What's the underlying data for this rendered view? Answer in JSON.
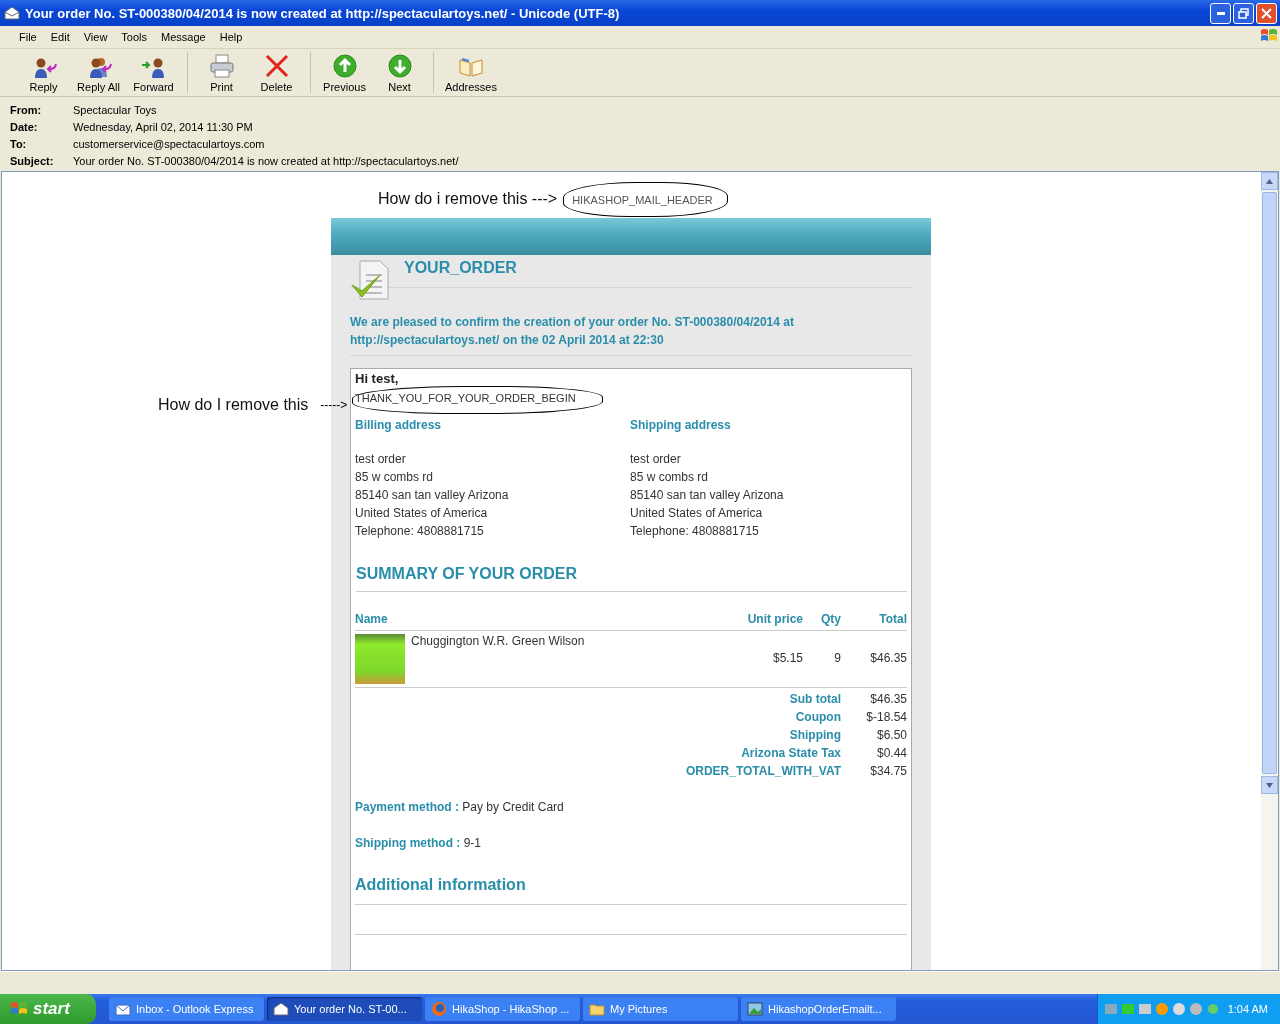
{
  "window": {
    "title": "Your order No. ST-000380/04/2014 is now created at http://spectaculartoys.net/ - Unicode (UTF-8)"
  },
  "menu": [
    "File",
    "Edit",
    "View",
    "Tools",
    "Message",
    "Help"
  ],
  "toolbar_groups": [
    {
      "buttons": [
        {
          "label": "Reply",
          "kind": "reply"
        },
        {
          "label": "Reply All",
          "kind": "replyall"
        },
        {
          "label": "Forward",
          "kind": "forward"
        }
      ]
    },
    {
      "buttons": [
        {
          "label": "Print",
          "kind": "print"
        },
        {
          "label": "Delete",
          "kind": "delete"
        }
      ]
    },
    {
      "buttons": [
        {
          "label": "Previous",
          "kind": "up"
        },
        {
          "label": "Next",
          "kind": "down"
        }
      ]
    },
    {
      "buttons": [
        {
          "label": "Addresses",
          "kind": "book"
        }
      ]
    }
  ],
  "headers": [
    {
      "label": "From:",
      "value": "Spectacular Toys"
    },
    {
      "label": "Date:",
      "value": "Wednesday, April 02, 2014 11:30 PM"
    },
    {
      "label": "To:",
      "value": "customerservice@spectaculartoys.com"
    },
    {
      "label": "Subject:",
      "value": "Your order No. ST-000380/04/2014 is now created at http://spectaculartoys.net/"
    }
  ],
  "annotations": [
    {
      "text": "How do i remove this --->"
    },
    {
      "text": "How do I remove this",
      "arrow": "----->"
    }
  ],
  "email": {
    "mail_header": "HIKASHOP_MAIL_HEADER",
    "title": "YOUR_ORDER",
    "intro": "We are pleased to confirm the creation of your order No. ST-000380/04/2014 at http://spectaculartoys.net/ on the 02 April 2014 at 22:30",
    "greeting": "Hi test,",
    "thank_you": "THANK_YOU_FOR_YOUR_ORDER_BEGIN",
    "addresses": [
      {
        "heading": "Billing address",
        "lines": [
          "test order",
          "85 w combs rd",
          "85140 san tan valley Arizona",
          "United States of America",
          "Telephone: 4808881715"
        ]
      },
      {
        "heading": "Shipping address",
        "lines": [
          "test order",
          "85 w combs rd",
          "85140 san tan valley Arizona",
          "United States of America",
          "Telephone: 4808881715"
        ]
      }
    ],
    "summary_heading": "SUMMARY OF YOUR ORDER",
    "columns": [
      "Name",
      "Unit price",
      "Qty",
      "Total"
    ],
    "items": [
      {
        "name": "Chuggington W.R. Green Wilson",
        "unit_price": "$5.15",
        "qty": "9",
        "total": "$46.35"
      }
    ],
    "totals": [
      {
        "label": "Sub total",
        "value": "$46.35"
      },
      {
        "label": "Coupon",
        "value": "$-18.54"
      },
      {
        "label": "Shipping",
        "value": "$6.50"
      },
      {
        "label": "Arizona State Tax",
        "value": "$0.44"
      },
      {
        "label": "ORDER_TOTAL_WITH_VAT",
        "value": "$34.75"
      }
    ],
    "methods": [
      {
        "label": "Payment method :",
        "value": "Pay by Credit Card"
      },
      {
        "label": "Shipping method :",
        "value": "9-1"
      }
    ],
    "additional_heading": "Additional information"
  },
  "taskbar": {
    "start": "start",
    "items": [
      {
        "label": "Inbox - Outlook Express",
        "kind": "outlook",
        "selected": false
      },
      {
        "label": "Your order No. ST-00...",
        "kind": "mail",
        "selected": true
      },
      {
        "label": "HikaShop - HikaShop ...",
        "kind": "firefox",
        "selected": false
      },
      {
        "label": "My Pictures",
        "kind": "folder",
        "selected": false
      },
      {
        "label": "HikashopOrderEmailt...",
        "kind": "image",
        "selected": false
      }
    ],
    "clock": "1:04 AM"
  }
}
